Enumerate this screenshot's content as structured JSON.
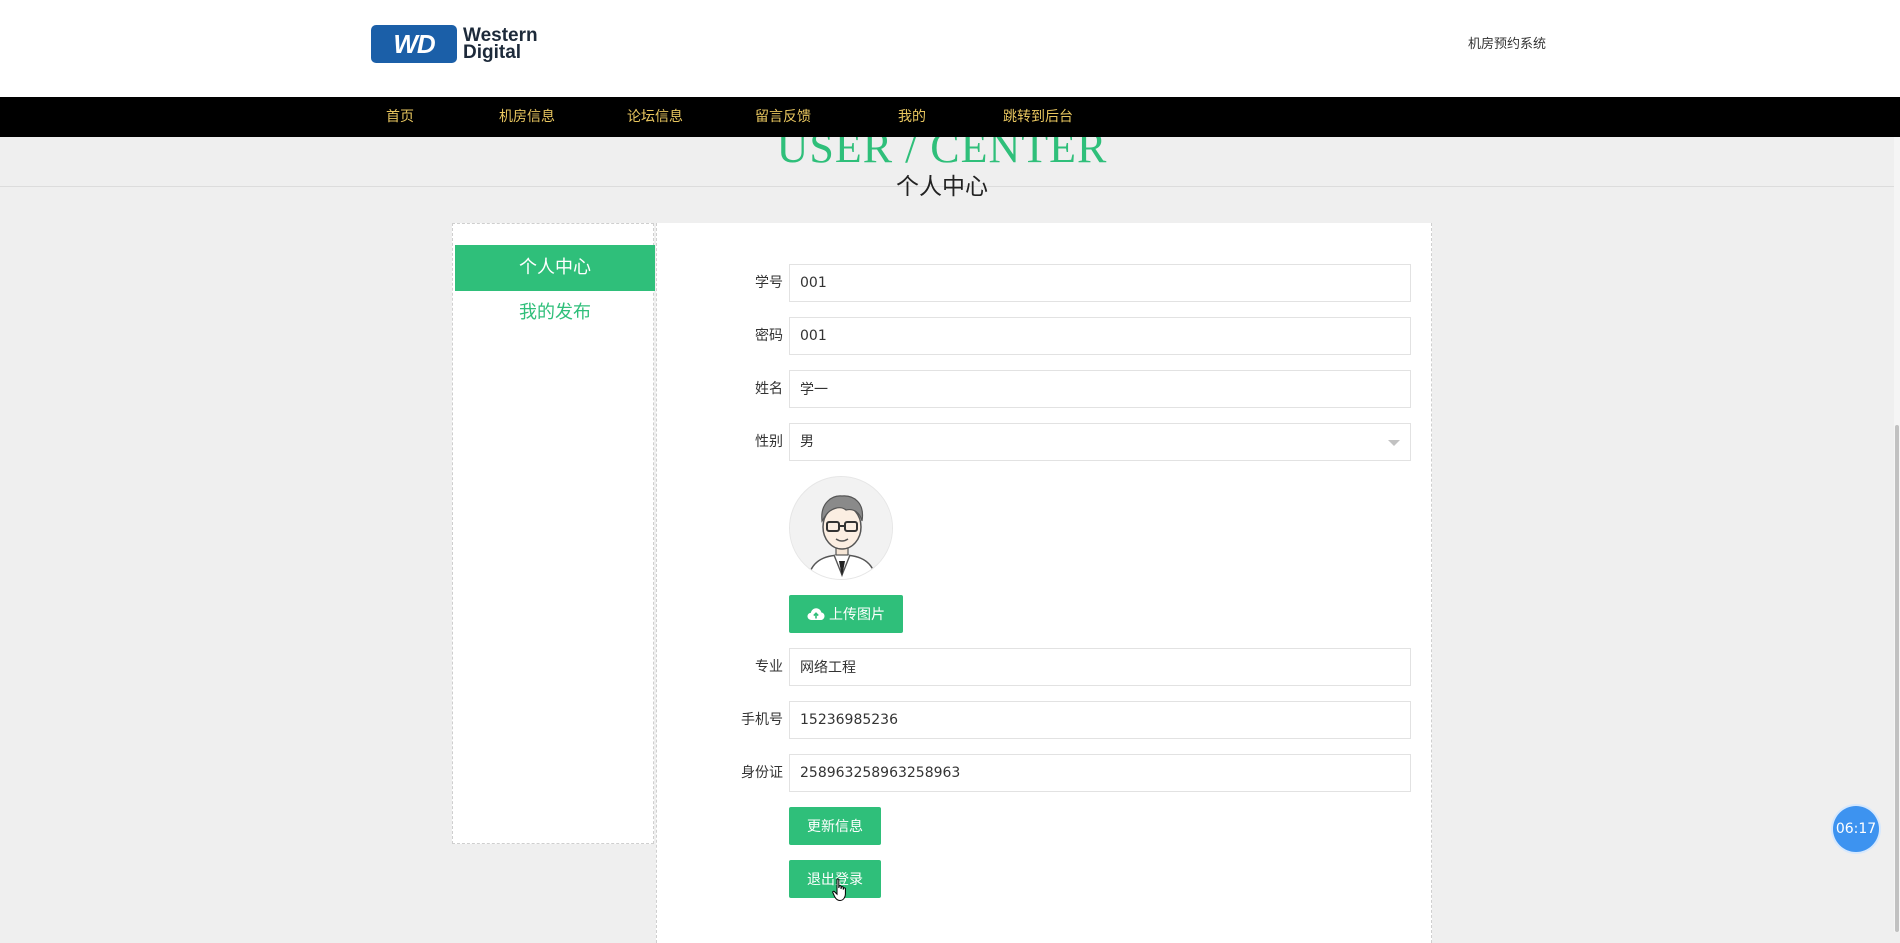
{
  "header": {
    "logo": {
      "badge": "WD",
      "line1": "Western",
      "line2": "Digital"
    },
    "site_title": "机房预约系统"
  },
  "nav": {
    "items": [
      {
        "label": "首页"
      },
      {
        "label": "机房信息"
      },
      {
        "label": "论坛信息"
      },
      {
        "label": "留言反馈"
      },
      {
        "label": "我的"
      },
      {
        "label": "跳转到后台"
      }
    ]
  },
  "section": {
    "title_en": "USER / CENTER",
    "title_cn": "个人中心"
  },
  "sidebar": {
    "items": [
      {
        "label": "个人中心",
        "active": true
      },
      {
        "label": "我的发布",
        "active": false
      }
    ]
  },
  "form": {
    "student_id": {
      "label": "学号",
      "value": "001"
    },
    "password": {
      "label": "密码",
      "value": "001"
    },
    "name": {
      "label": "姓名",
      "value": "学一"
    },
    "gender": {
      "label": "性别",
      "value": "男"
    },
    "upload_label": "上传图片",
    "major": {
      "label": "专业",
      "value": "网络工程"
    },
    "phone": {
      "label": "手机号",
      "value": "15236985236"
    },
    "id_card": {
      "label": "身份证",
      "value": "258963258963258963"
    },
    "update_label": "更新信息",
    "logout_label": "退出登录"
  },
  "timer": "06:17",
  "colors": {
    "accent": "#2fbf7a",
    "nav_bg": "#000000",
    "nav_text": "#e8c65f",
    "page_bg": "#efefef",
    "timer_bg": "#3d93f0",
    "logo_blue": "#1b5fa8"
  },
  "icons": {
    "upload": "cloud-upload-icon",
    "select": "chevron-down-icon",
    "avatar": "user-avatar-icon"
  }
}
